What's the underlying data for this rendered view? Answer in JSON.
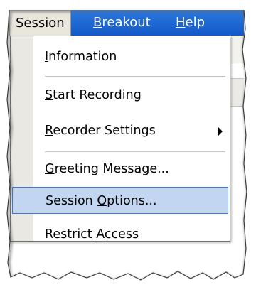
{
  "menubar": {
    "items": [
      {
        "label": "Session",
        "mnemonic_char": "n",
        "active": true
      },
      {
        "label": "Breakout",
        "mnemonic_char": "B",
        "active": false
      },
      {
        "label": "Help",
        "mnemonic_char": "H",
        "active": false
      }
    ]
  },
  "session_menu": {
    "items": [
      {
        "label": "Information",
        "mnemonic_char": "I"
      },
      {
        "label": "Start Recording",
        "mnemonic_char": "S"
      },
      {
        "label": "Recorder Settings",
        "mnemonic_char": "R",
        "has_submenu": true
      },
      {
        "label": "Greeting Message...",
        "mnemonic_char": "G"
      },
      {
        "label": "Session Options...",
        "mnemonic_char": "O",
        "selected": true
      },
      {
        "label": "Restrict Access",
        "mnemonic_char": "A"
      }
    ]
  },
  "colors": {
    "menubar_bg": "#1a66d2",
    "selection_bg": "#c2d6f2",
    "selection_border": "#3d79d4",
    "gutter": "#e9e8e2"
  }
}
